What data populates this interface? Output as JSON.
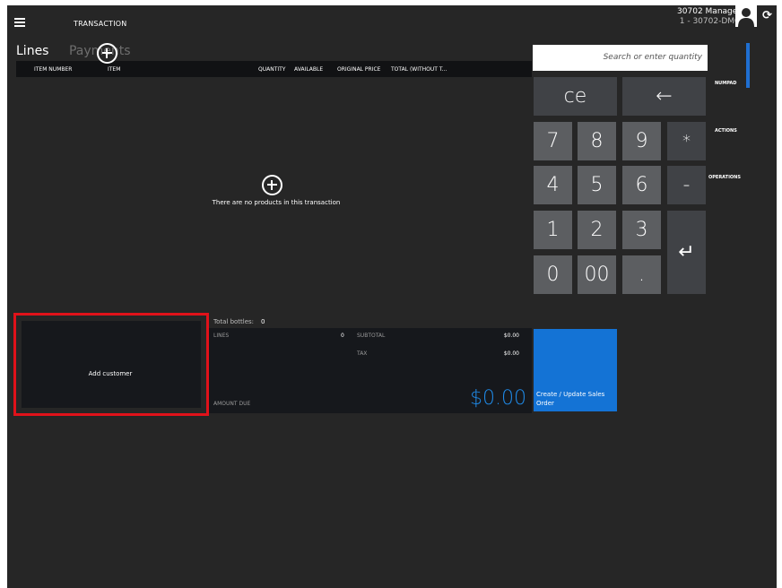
{
  "header": {
    "title": "TRANSACTION",
    "user_name": "30702 Manager",
    "user_id": "1 - 30702-DMG"
  },
  "tabs": [
    "Lines",
    "Payments"
  ],
  "grid": {
    "columns": [
      "ITEM NUMBER",
      "ITEM",
      "QUANTITY",
      "AVAILABLE",
      "ORIGINAL PRICE",
      "TOTAL (WITHOUT T..."
    ],
    "empty_text": "There are no products in this transaction"
  },
  "customer": {
    "label": "Add customer"
  },
  "totals": {
    "bottles_label": "Total bottles:",
    "bottles_value": "0",
    "lines_label": "LINES",
    "lines_value": "0",
    "subtotal_label": "SUBTOTAL",
    "subtotal_value": "$0.00",
    "tax_label": "TAX",
    "tax_value": "$0.00",
    "amount_due_label": "AMOUNT DUE",
    "amount_due_value": "$0.00"
  },
  "numpad": {
    "search_placeholder": "Search or enter quantity",
    "ce": "ce",
    "backspace": "←",
    "k7": "7",
    "k8": "8",
    "k9": "9",
    "mult": "*",
    "k4": "4",
    "k5": "5",
    "k6": "6",
    "minus": "-",
    "k1": "1",
    "k2": "2",
    "k3": "3",
    "enter": "↵",
    "k0": "0",
    "k00": "00",
    "dot": "."
  },
  "side_tabs": [
    "NUMPAD",
    "ACTIONS",
    "OPERATIONS"
  ],
  "create_order_label": "Create / Update Sales Order",
  "colors": {
    "accent": "#1473d5",
    "highlight": "#e0121a",
    "background": "#262626"
  }
}
